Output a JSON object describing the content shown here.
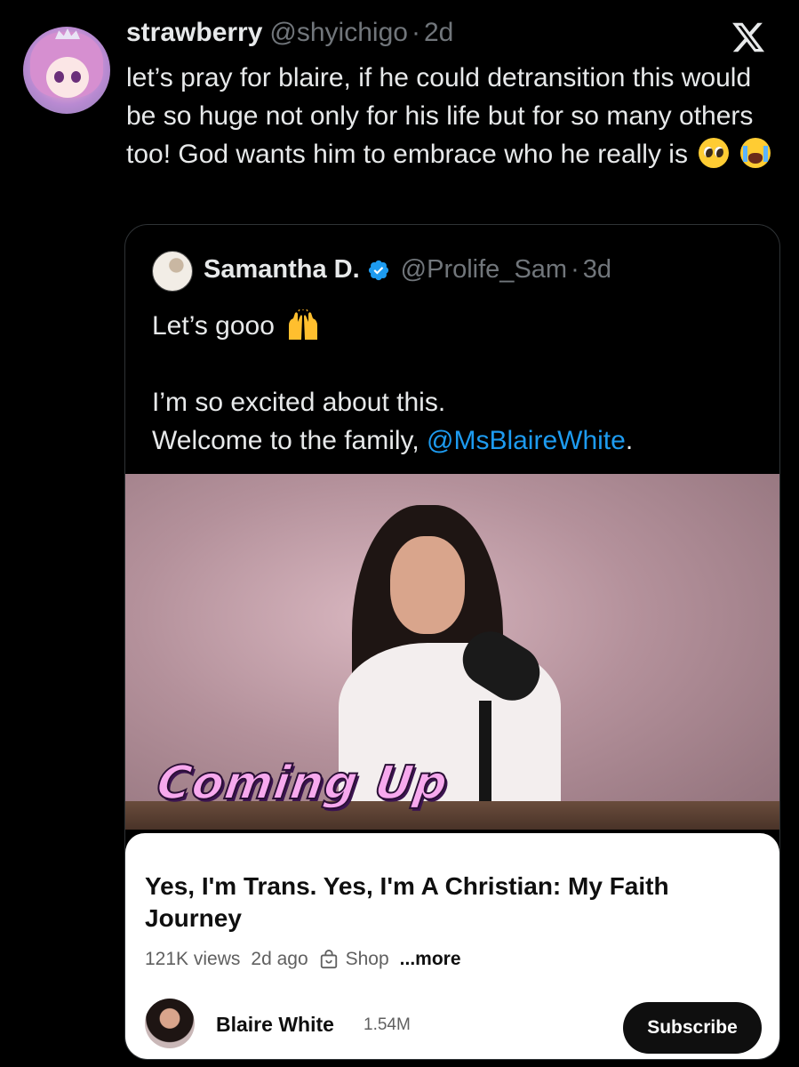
{
  "tweet": {
    "display_name": "strawberry",
    "handle": "@shyichigo",
    "separator": "·",
    "time": "2d",
    "text": "let’s pray for blaire, if he could detransition this would be so huge not only for his life but for so many others too! God wants him to embrace who he really is",
    "emojis": [
      "pleading-face",
      "loudly-crying-face"
    ]
  },
  "quoted_tweet": {
    "display_name": "Samantha D.",
    "handle": "@Prolife_Sam",
    "separator": "·",
    "time": "3d",
    "line1": "Let’s gooo",
    "line2": "I’m so excited about this.",
    "line3_prefix": "Welcome to the family, ",
    "mention": "@MsBlaireWhite",
    "line3_suffix": ".",
    "emoji": "raising-hands",
    "link_color": "#1d9bf0"
  },
  "video": {
    "overlay_text": "Coming Up",
    "title": "Yes, I'm Trans. Yes, I'm A Christian: My Faith Journey",
    "views": "121K views",
    "age": "2d ago",
    "shop_label": "Shop",
    "more_label": "...more",
    "channel_name": "Blaire White",
    "subscribers": "1.54M",
    "subscribe_label": "Subscribe"
  },
  "colors": {
    "background": "#000000",
    "text_primary": "#e7e9ea",
    "text_secondary": "#71767b",
    "verified_blue": "#1d9bf0"
  }
}
